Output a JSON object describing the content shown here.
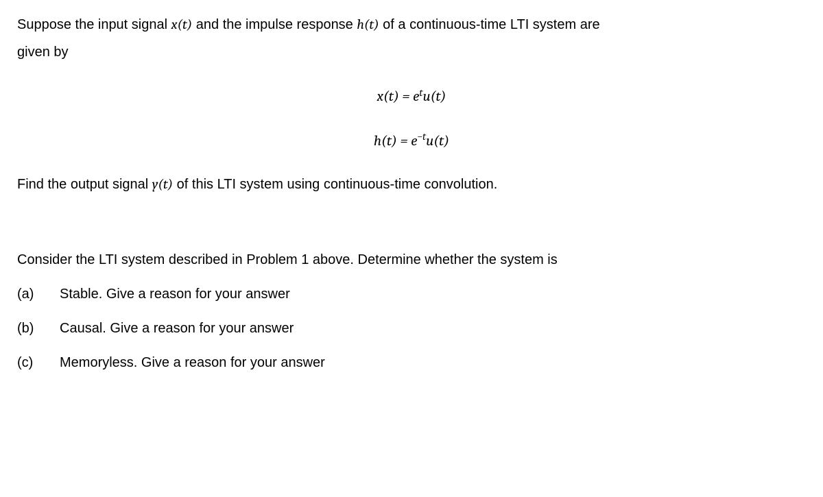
{
  "p1_part1": "Suppose the input signal ",
  "p1_math1": "x(t)",
  "p1_part2": " and the impulse response ",
  "p1_math2": "h(t)",
  "p1_part3": " of a continuous-time LTI system are",
  "p2": "given by",
  "eq1_pre": "x(t) = e",
  "eq1_sup": "t",
  "eq1_post": "u(t)",
  "eq2_pre": "h(t) = e",
  "eq2_sup": "−t",
  "eq2_post": "u(t)",
  "p3_part1": "Find the output signal ",
  "p3_math": "y(t)",
  "p3_part2": " of this LTI system using continuous-time convolution.",
  "p4": "Consider the LTI system described in Problem 1 above. Determine whether the system is",
  "qa_label": "(a)",
  "qa_text": "Stable. Give a reason for your answer",
  "qb_label": "(b)",
  "qb_text": "Causal. Give a reason for your answer",
  "qc_label": "(c)",
  "qc_text": "Memoryless. Give a reason for your answer"
}
